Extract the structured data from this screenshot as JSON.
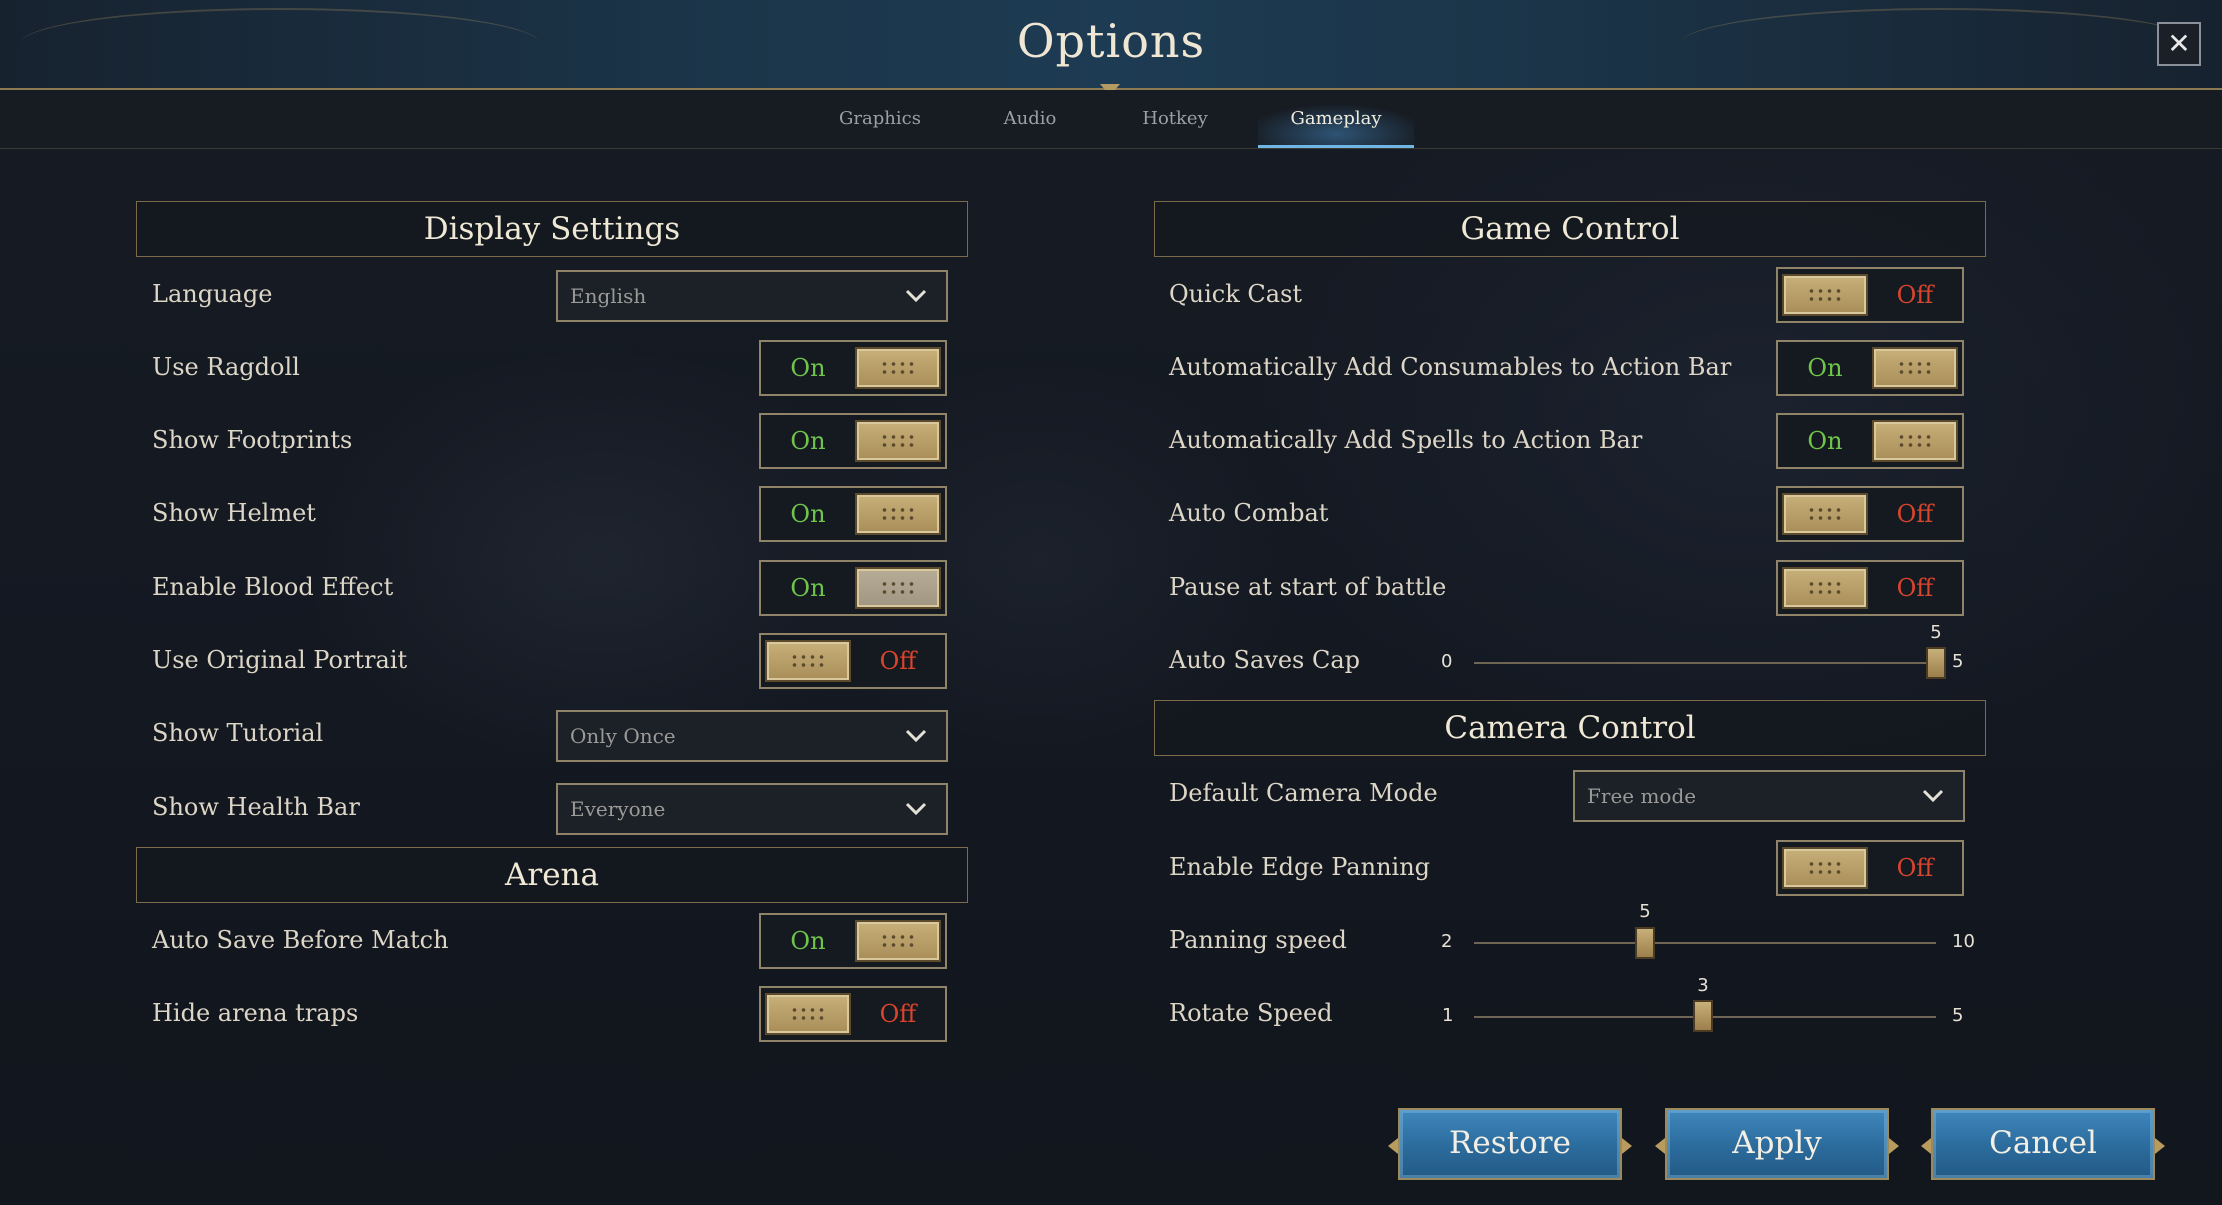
{
  "window": {
    "title": "Options",
    "close_glyph": "✕"
  },
  "tabs": [
    {
      "label": "Graphics",
      "active": false
    },
    {
      "label": "Audio",
      "active": false
    },
    {
      "label": "Hotkey",
      "active": false
    },
    {
      "label": "Gameplay",
      "active": true
    }
  ],
  "toggle_text": {
    "on": "On",
    "off": "Off"
  },
  "display_settings": {
    "title": "Display Settings",
    "language": {
      "label": "Language",
      "value": "English"
    },
    "use_ragdoll": {
      "label": "Use Ragdoll",
      "state": "On"
    },
    "show_footprints": {
      "label": "Show Footprints",
      "state": "On"
    },
    "show_helmet": {
      "label": "Show Helmet",
      "state": "On"
    },
    "enable_blood_effect": {
      "label": "Enable Blood Effect",
      "state": "On"
    },
    "use_original_portrait": {
      "label": "Use Original Portrait",
      "state": "Off"
    },
    "show_tutorial": {
      "label": "Show Tutorial",
      "value": "Only Once"
    },
    "show_health_bar": {
      "label": "Show Health Bar",
      "value": "Everyone"
    }
  },
  "arena": {
    "title": "Arena",
    "auto_save_before_match": {
      "label": "Auto Save Before Match",
      "state": "On"
    },
    "hide_arena_traps": {
      "label": "Hide arena traps",
      "state": "Off"
    }
  },
  "game_control": {
    "title": "Game Control",
    "quick_cast": {
      "label": "Quick Cast",
      "state": "Off"
    },
    "auto_add_consumables": {
      "label": "Automatically Add Consumables to Action Bar",
      "state": "On"
    },
    "auto_add_spells": {
      "label": "Automatically Add Spells to Action Bar",
      "state": "On"
    },
    "auto_combat": {
      "label": "Auto Combat",
      "state": "Off"
    },
    "pause_at_start_of_battle": {
      "label": "Pause at start of battle",
      "state": "Off"
    },
    "auto_saves_cap": {
      "label": "Auto Saves Cap",
      "min": "0",
      "max": "5",
      "value": "5"
    }
  },
  "camera_control": {
    "title": "Camera Control",
    "default_camera_mode": {
      "label": "Default Camera Mode",
      "value": "Free mode"
    },
    "enable_edge_panning": {
      "label": "Enable Edge Panning",
      "state": "Off"
    },
    "panning_speed": {
      "label": "Panning speed",
      "min": "2",
      "max": "10",
      "value": "5"
    },
    "rotate_speed": {
      "label": "Rotate Speed",
      "min": "1",
      "max": "5",
      "value": "3"
    }
  },
  "buttons": {
    "restore": "Restore",
    "apply": "Apply",
    "cancel": "Cancel"
  },
  "colors": {
    "on": "#6fc54a",
    "off": "#d9442d",
    "accent": "#6fb5e6",
    "gold": "#8f8468"
  }
}
